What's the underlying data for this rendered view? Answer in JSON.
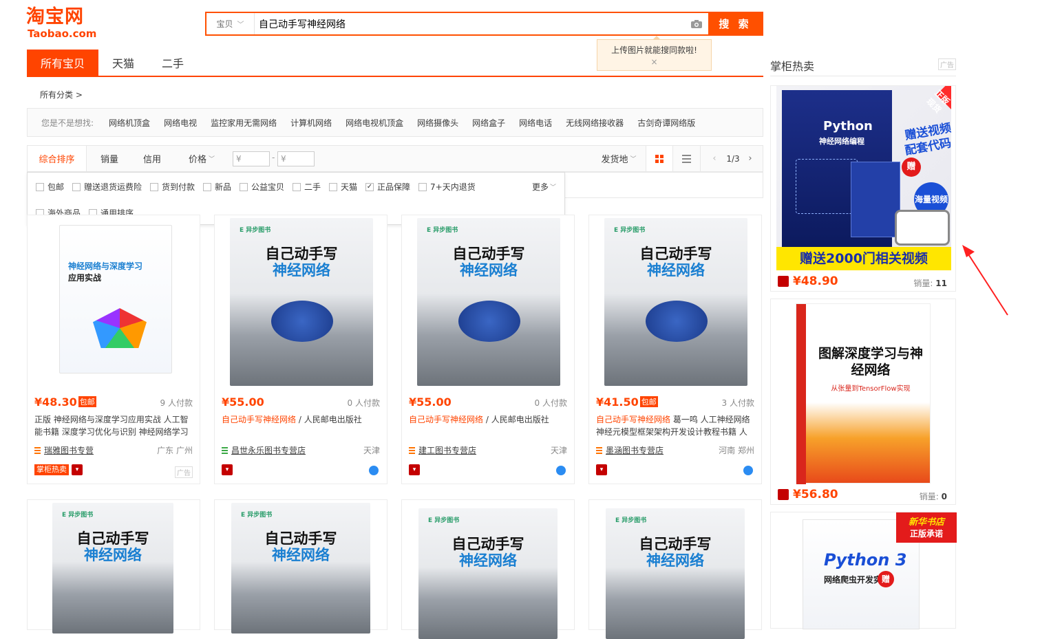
{
  "header": {
    "logo_cn": "淘宝网",
    "logo_en": "Taobao.com",
    "search_category": "宝贝",
    "search_value": "自己动手写神经网络",
    "search_button": "搜 索",
    "upload_tip": "上传图片就能搜同款啦!",
    "upload_tip_close": "×"
  },
  "tabs": [
    {
      "label": "所有宝贝"
    },
    {
      "label": "天猫"
    },
    {
      "label": "二手"
    }
  ],
  "all_categories": "所有分类 >",
  "suggest": {
    "label": "您是不是想找:",
    "keywords": [
      "网络机顶盒",
      "网络电视",
      "监控家用无需网络",
      "计算机网络",
      "网络电视机顶盒",
      "网络摄像头",
      "网络盒子",
      "网络电话",
      "无线网络接收器",
      "古剑奇谭网络版"
    ]
  },
  "sort": {
    "items": [
      "综合排序",
      "销量",
      "信用",
      "价格"
    ],
    "price_min_placeholder": "¥",
    "price_max_placeholder": "¥",
    "price_sep": "-",
    "ship_from": "发货地",
    "page": "1/3"
  },
  "filters": {
    "row1": [
      {
        "label": "包邮",
        "checked": false
      },
      {
        "label": "赠送退货运费险",
        "checked": false
      },
      {
        "label": "货到付款",
        "checked": false
      },
      {
        "label": "新品",
        "checked": false
      },
      {
        "label": "公益宝贝",
        "checked": false
      },
      {
        "label": "二手",
        "checked": false
      },
      {
        "label": "天猫",
        "checked": false
      },
      {
        "label": "正品保障",
        "checked": true
      },
      {
        "label": "7+天内退货",
        "checked": false
      }
    ],
    "more": "更多",
    "row2": [
      {
        "label": "海外商品",
        "checked": false
      },
      {
        "label": "通用排序",
        "checked": false
      }
    ]
  },
  "products": [
    {
      "price": "¥48.30",
      "badge": "包邮",
      "paid": "9 人付款",
      "title_hl": "",
      "title_rest": "正版 神经网络与深度学习应用实战 人工智能书籍 深度学习优化与识别 神经网络学习",
      "shop": "瑞雅图书专营",
      "loc": "广东 广州",
      "tag": "掌柜热卖",
      "ad": "广告",
      "cover_title": "神经网络与深度学习",
      "cover_sub": "应用实战"
    },
    {
      "price": "¥55.00",
      "badge": "",
      "paid": "0 人付款",
      "title_hl": "自己动手写神经网络",
      "title_rest": " / 人民邮电出版社",
      "shop": "昌世永乐图书专营店",
      "loc": "天津",
      "cover_title": "自己动手写",
      "cover_sub": "神经网络"
    },
    {
      "price": "¥55.00",
      "badge": "",
      "paid": "0 人付款",
      "title_hl": "自己动手写神经网络",
      "title_rest": " / 人民邮电出版社",
      "shop": "建工图书专营店",
      "loc": "天津",
      "cover_title": "自己动手写",
      "cover_sub": "神经网络"
    },
    {
      "price": "¥41.50",
      "badge": "包邮",
      "paid": "3 人付款",
      "title_hl": "自己动手写神经网络",
      "title_rest": " 葛一鸣 人工神经网络神经元模型框架架构开发设计教程书籍 人",
      "shop": "墨涵图书专营店",
      "loc": "河南 郑州",
      "cover_title": "自己动手写",
      "cover_sub": "神经网络"
    }
  ],
  "products_row2": [
    {
      "cover_title": "自己动手写",
      "cover_sub": "神经网络"
    },
    {
      "cover_title": "自己动手写",
      "cover_sub": "神经网络"
    },
    {
      "cover_title": "自己动手写",
      "cover_sub": "神经网络"
    },
    {
      "cover_title": "自己动手写",
      "cover_sub": "神经网络"
    }
  ],
  "right": {
    "title": "掌柜热卖",
    "ad": "广告",
    "items": [
      {
        "cover_title": "Python",
        "cover_sub": "神经网络编程",
        "banner": "赠送2000门相关视频",
        "corner": "正版现货",
        "promo1": "赠送视频",
        "promo2": "配套代码",
        "promo3": "海量视频",
        "gift": "赠",
        "price": "¥48.90",
        "sales_label": "销量:",
        "sales": "11"
      },
      {
        "cover_title": "图解深度学习与神经网络",
        "cover_sub": "从张量到TensorFlow实现",
        "price": "¥56.80",
        "sales_label": "销量:",
        "sales": "0"
      },
      {
        "cover_title": "Python 3",
        "cover_sub": "网络爬虫开发实战",
        "corner": "新华书店",
        "corner2": "正版承诺",
        "gift": "赠"
      }
    ]
  },
  "colors": {
    "accent": "#ff4400",
    "search_border": "#ff5000"
  }
}
